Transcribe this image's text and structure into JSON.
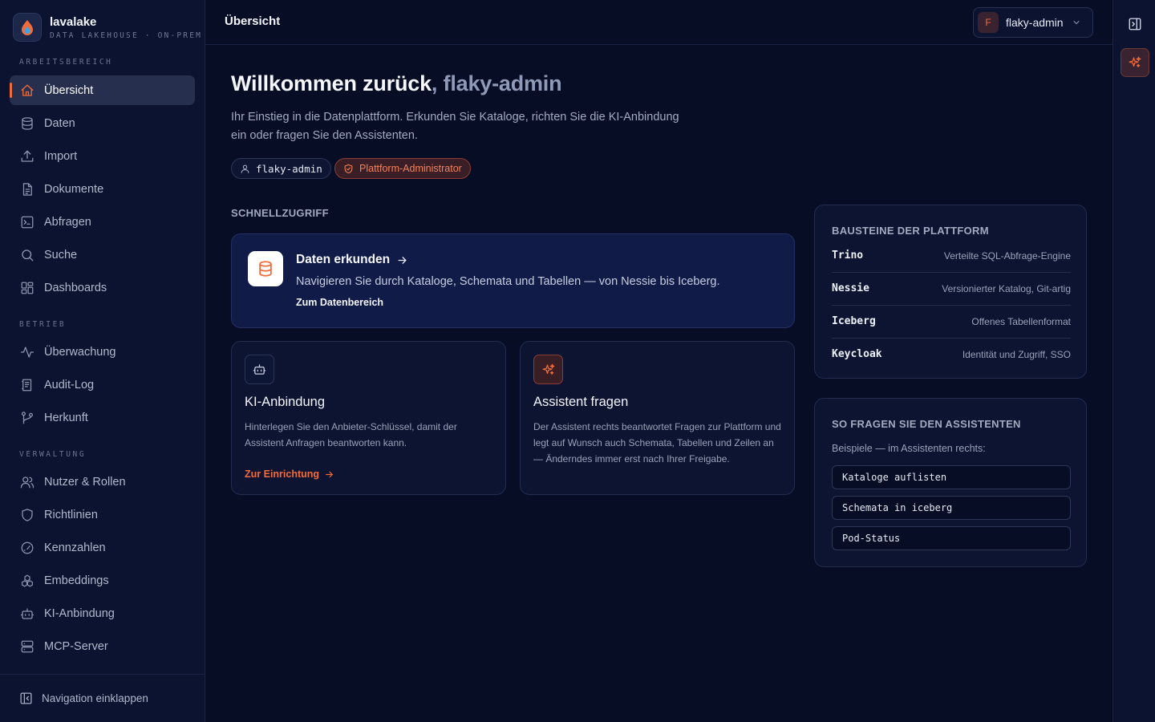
{
  "brand": {
    "name": "lavalake",
    "subtitle": "DATA LAKEHOUSE · ON-PREM"
  },
  "sidebar": {
    "sections": [
      {
        "label": "ARBEITSBEREICH"
      },
      {
        "label": "BETRIEB"
      },
      {
        "label": "VERWALTUNG"
      }
    ],
    "items": [
      {
        "label": "Übersicht",
        "icon": "home-icon",
        "active": true
      },
      {
        "label": "Daten",
        "icon": "database-icon"
      },
      {
        "label": "Import",
        "icon": "upload-icon"
      },
      {
        "label": "Dokumente",
        "icon": "document-icon"
      },
      {
        "label": "Abfragen",
        "icon": "terminal-icon"
      },
      {
        "label": "Suche",
        "icon": "search-icon"
      },
      {
        "label": "Dashboards",
        "icon": "dashboard-icon"
      },
      {
        "label": "Überwachung",
        "icon": "activity-icon"
      },
      {
        "label": "Audit-Log",
        "icon": "log-icon"
      },
      {
        "label": "Herkunft",
        "icon": "lineage-icon"
      },
      {
        "label": "Nutzer & Rollen",
        "icon": "users-icon"
      },
      {
        "label": "Richtlinien",
        "icon": "shield-icon"
      },
      {
        "label": "Kennzahlen",
        "icon": "gauge-icon"
      },
      {
        "label": "Embeddings",
        "icon": "embeddings-icon"
      },
      {
        "label": "KI-Anbindung",
        "icon": "bot-icon"
      },
      {
        "label": "MCP-Server",
        "icon": "server-icon"
      }
    ],
    "collapse_label": "Navigation einklappen"
  },
  "topbar": {
    "title": "Übersicht",
    "user": {
      "initial": "F",
      "name": "flaky-admin"
    }
  },
  "main": {
    "welcome_prefix": "Willkommen zurück",
    "welcome_comma": ",",
    "welcome_user": "flaky-admin",
    "intro": "Ihr Einstieg in die Datenplattform. Erkunden Sie Kataloge, richten Sie die KI-Anbindung ein oder fragen Sie den Assistenten.",
    "chips": {
      "user": "flaky-admin",
      "role": "Plattform-Administrator"
    },
    "quick_access_label": "SCHNELLZUGRIFF",
    "hero": {
      "title": "Daten erkunden",
      "description": "Navigieren Sie durch Kataloge, Schemata und Tabellen — von Nessie bis Iceberg.",
      "link": "Zum Datenbereich"
    },
    "ki_card": {
      "title": "KI-Anbindung",
      "description": "Hinterlegen Sie den Anbieter-Schlüssel, damit der Assistent Anfragen beantworten kann.",
      "link": "Zur Einrichtung"
    },
    "assist_card": {
      "title": "Assistent fragen",
      "description": "Der Assistent rechts beantwortet Fragen zur Plattform und legt auf Wunsch auch Schemata, Tabellen und Zeilen an — Änderndes immer erst nach Ihrer Freigabe."
    },
    "components": {
      "title": "BAUSTEINE DER PLATTFORM",
      "rows": [
        {
          "name": "Trino",
          "desc": "Verteilte SQL-Abfrage-Engine"
        },
        {
          "name": "Nessie",
          "desc": "Versionierter Katalog, Git-artig"
        },
        {
          "name": "Iceberg",
          "desc": "Offenes Tabellenformat"
        },
        {
          "name": "Keycloak",
          "desc": "Identität und Zugriff, SSO"
        }
      ]
    },
    "ask": {
      "title": "SO FRAGEN SIE DEN ASSISTENTEN",
      "subtitle": "Beispiele — im Assistenten rechts:",
      "examples": [
        "Kataloge auflisten",
        "Schemata in iceberg",
        "Pod-Status"
      ]
    }
  },
  "colors": {
    "accent": "#f26b3a",
    "background": "#070d24",
    "sidebar": "#0b1330",
    "active_item": "#262f4e"
  }
}
